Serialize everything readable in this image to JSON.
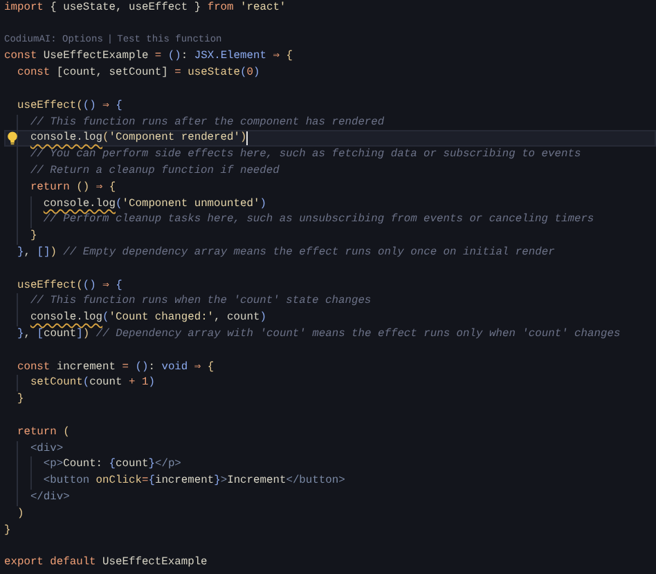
{
  "editor": {
    "lines": [
      {
        "kind": "code",
        "tokens": [
          {
            "kind": "keyword",
            "text": "import"
          },
          {
            "kind": "punct",
            "text": " { "
          },
          {
            "kind": "variable",
            "text": "useState, useEffect"
          },
          {
            "kind": "punct",
            "text": " } "
          },
          {
            "kind": "keyword",
            "text": "from"
          },
          {
            "kind": "string",
            "text": " 'react'"
          }
        ]
      },
      {
        "kind": "blank"
      },
      {
        "kind": "codelens",
        "links": [
          "CodiumAI: Options",
          "Test this function"
        ],
        "separator": "|"
      },
      {
        "kind": "code",
        "tokens": [
          {
            "kind": "keyword",
            "text": "const "
          },
          {
            "kind": "variable",
            "text": "UseEffectExample "
          },
          {
            "kind": "operator",
            "text": "= "
          },
          {
            "kind": "paren",
            "text": "()"
          },
          {
            "kind": "punct",
            "text": ": "
          },
          {
            "kind": "type",
            "text": "JSX.Element "
          },
          {
            "kind": "operator",
            "text": "⇒ "
          },
          {
            "kind": "bracket",
            "text": "{"
          }
        ]
      },
      {
        "kind": "code",
        "tokens": [
          {
            "kind": "keyword",
            "text": "  const "
          },
          {
            "kind": "variable",
            "text": "[count, setCount] "
          },
          {
            "kind": "operator",
            "text": "= "
          },
          {
            "kind": "function",
            "text": "useState"
          },
          {
            "kind": "paren",
            "text": "("
          },
          {
            "kind": "number",
            "text": "0"
          },
          {
            "kind": "paren",
            "text": ")"
          }
        ]
      },
      {
        "kind": "blank"
      },
      {
        "kind": "code",
        "tokens": [
          {
            "kind": "function",
            "text": "  useEffect"
          },
          {
            "kind": "bracket",
            "text": "("
          },
          {
            "kind": "paren",
            "text": "() "
          },
          {
            "kind": "operator",
            "text": "⇒ "
          },
          {
            "kind": "paren",
            "text": "{"
          }
        ]
      },
      {
        "kind": "code",
        "tokens": [
          {
            "kind": "comment",
            "text": "    // This function runs after the component has rendered"
          }
        ]
      },
      {
        "kind": "code",
        "current": true,
        "lightbulb": true,
        "tokens": [
          {
            "kind": "variable",
            "text": "    console.log",
            "warning": true
          },
          {
            "kind": "bracket",
            "text": "("
          },
          {
            "kind": "string",
            "text": "'Component rendered'"
          },
          {
            "kind": "bracket",
            "text": ")"
          }
        ]
      },
      {
        "kind": "code",
        "tokens": [
          {
            "kind": "comment",
            "text": "    // You can perform side effects here, such as fetching data or subscribing to events"
          }
        ]
      },
      {
        "kind": "code",
        "tokens": [
          {
            "kind": "comment",
            "text": "    // Return a cleanup function if needed"
          }
        ]
      },
      {
        "kind": "code",
        "tokens": [
          {
            "kind": "keyword",
            "text": "    return "
          },
          {
            "kind": "bracket",
            "text": "() "
          },
          {
            "kind": "operator",
            "text": "⇒ "
          },
          {
            "kind": "bracket",
            "text": "{"
          }
        ]
      },
      {
        "kind": "code",
        "tokens": [
          {
            "kind": "variable",
            "text": "      console.log",
            "warning": true
          },
          {
            "kind": "paren",
            "text": "("
          },
          {
            "kind": "string",
            "text": "'Component unmounted'"
          },
          {
            "kind": "paren",
            "text": ")"
          }
        ]
      },
      {
        "kind": "code",
        "tokens": [
          {
            "kind": "comment",
            "text": "      // Perform cleanup tasks here, such as unsubscribing from events or canceling timers"
          }
        ]
      },
      {
        "kind": "code",
        "tokens": [
          {
            "kind": "bracket",
            "text": "    }"
          }
        ]
      },
      {
        "kind": "code",
        "tokens": [
          {
            "kind": "paren",
            "text": "  }"
          },
          {
            "kind": "punct",
            "text": ", "
          },
          {
            "kind": "paren",
            "text": "[]"
          },
          {
            "kind": "bracket",
            "text": ") "
          },
          {
            "kind": "comment",
            "text": "// Empty dependency array means the effect runs only once on initial render"
          }
        ]
      },
      {
        "kind": "blank"
      },
      {
        "kind": "code",
        "tokens": [
          {
            "kind": "function",
            "text": "  useEffect"
          },
          {
            "kind": "bracket",
            "text": "("
          },
          {
            "kind": "paren",
            "text": "() "
          },
          {
            "kind": "operator",
            "text": "⇒ "
          },
          {
            "kind": "paren",
            "text": "{"
          }
        ]
      },
      {
        "kind": "code",
        "tokens": [
          {
            "kind": "comment",
            "text": "    // This function runs when the 'count' state changes"
          }
        ]
      },
      {
        "kind": "code",
        "tokens": [
          {
            "kind": "variable",
            "text": "    console.log",
            "warning": true
          },
          {
            "kind": "paren",
            "text": "("
          },
          {
            "kind": "string",
            "text": "'Count changed:'"
          },
          {
            "kind": "punct",
            "text": ", "
          },
          {
            "kind": "variable",
            "text": "count"
          },
          {
            "kind": "paren",
            "text": ")"
          }
        ]
      },
      {
        "kind": "code",
        "tokens": [
          {
            "kind": "paren",
            "text": "  }"
          },
          {
            "kind": "punct",
            "text": ", "
          },
          {
            "kind": "paren",
            "text": "["
          },
          {
            "kind": "variable",
            "text": "count"
          },
          {
            "kind": "paren",
            "text": "]"
          },
          {
            "kind": "bracket",
            "text": ") "
          },
          {
            "kind": "comment",
            "text": "// Dependency array with 'count' means the effect runs only when 'count' changes"
          }
        ]
      },
      {
        "kind": "blank"
      },
      {
        "kind": "code",
        "tokens": [
          {
            "kind": "keyword",
            "text": "  const "
          },
          {
            "kind": "variable",
            "text": "increment "
          },
          {
            "kind": "operator",
            "text": "= "
          },
          {
            "kind": "paren",
            "text": "()"
          },
          {
            "kind": "punct",
            "text": ": "
          },
          {
            "kind": "type",
            "text": "void "
          },
          {
            "kind": "operator",
            "text": "⇒ "
          },
          {
            "kind": "bracket",
            "text": "{"
          }
        ]
      },
      {
        "kind": "code",
        "tokens": [
          {
            "kind": "function",
            "text": "    setCount"
          },
          {
            "kind": "paren",
            "text": "("
          },
          {
            "kind": "variable",
            "text": "count "
          },
          {
            "kind": "operator",
            "text": "+ "
          },
          {
            "kind": "number",
            "text": "1"
          },
          {
            "kind": "paren",
            "text": ")"
          }
        ]
      },
      {
        "kind": "code",
        "tokens": [
          {
            "kind": "bracket",
            "text": "  }"
          }
        ]
      },
      {
        "kind": "blank"
      },
      {
        "kind": "code",
        "tokens": [
          {
            "kind": "keyword",
            "text": "  return "
          },
          {
            "kind": "bracket",
            "text": "("
          }
        ]
      },
      {
        "kind": "code",
        "tokens": [
          {
            "kind": "tag",
            "text": "    <div>"
          }
        ]
      },
      {
        "kind": "code",
        "tokens": [
          {
            "kind": "tag",
            "text": "      <p>"
          },
          {
            "kind": "variable",
            "text": "Count: "
          },
          {
            "kind": "paren",
            "text": "{"
          },
          {
            "kind": "variable",
            "text": "count"
          },
          {
            "kind": "paren",
            "text": "}"
          },
          {
            "kind": "tag",
            "text": "</p>"
          }
        ]
      },
      {
        "kind": "code",
        "tokens": [
          {
            "kind": "tag",
            "text": "      <button "
          },
          {
            "kind": "function",
            "text": "onClick"
          },
          {
            "kind": "operator",
            "text": "="
          },
          {
            "kind": "paren",
            "text": "{"
          },
          {
            "kind": "variable",
            "text": "increment"
          },
          {
            "kind": "paren",
            "text": "}"
          },
          {
            "kind": "tag",
            "text": ">"
          },
          {
            "kind": "variable",
            "text": "Increment"
          },
          {
            "kind": "tag",
            "text": "</button>"
          }
        ]
      },
      {
        "kind": "code",
        "tokens": [
          {
            "kind": "tag",
            "text": "    </div>"
          }
        ]
      },
      {
        "kind": "code",
        "tokens": [
          {
            "kind": "bracket",
            "text": "  )"
          }
        ]
      },
      {
        "kind": "code",
        "tokens": [
          {
            "kind": "bracket",
            "text": "}"
          }
        ]
      },
      {
        "kind": "blank"
      },
      {
        "kind": "code",
        "tokens": [
          {
            "kind": "keyword",
            "text": "export default "
          },
          {
            "kind": "variable",
            "text": "UseEffectExample"
          }
        ]
      }
    ]
  }
}
